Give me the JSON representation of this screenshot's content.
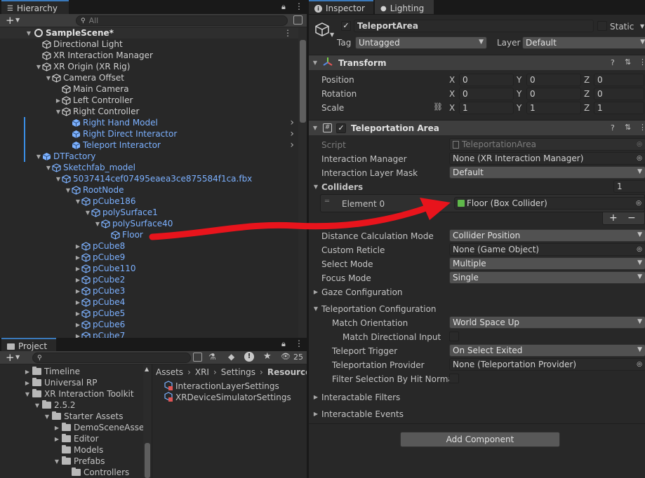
{
  "hierarchy": {
    "tab_label": "Hierarchy",
    "search_placeholder": "All",
    "scene_name": "SampleScene*",
    "rows": [
      {
        "label": "Directional Light",
        "depth": 1,
        "arrow": "",
        "color": "normal"
      },
      {
        "label": "XR Interaction Manager",
        "depth": 1,
        "arrow": "",
        "color": "normal"
      },
      {
        "label": "XR Origin (XR Rig)",
        "depth": 1,
        "arrow": "open",
        "color": "normal"
      },
      {
        "label": "Camera Offset",
        "depth": 2,
        "arrow": "open",
        "color": "normal"
      },
      {
        "label": "Main Camera",
        "depth": 3,
        "arrow": "",
        "color": "normal"
      },
      {
        "label": "Left Controller",
        "depth": 3,
        "arrow": "closed",
        "color": "normal"
      },
      {
        "label": "Right Controller",
        "depth": 3,
        "arrow": "open",
        "color": "normal"
      },
      {
        "label": "Right Hand Model",
        "depth": 4,
        "arrow": "",
        "color": "prefab"
      },
      {
        "label": "Right Direct Interactor",
        "depth": 4,
        "arrow": "",
        "color": "prefab"
      },
      {
        "label": "Teleport Interactor",
        "depth": 4,
        "arrow": "",
        "color": "prefab"
      },
      {
        "label": "DTFactory",
        "depth": 1,
        "arrow": "open",
        "color": "prefab"
      },
      {
        "label": "Sketchfab_model",
        "depth": 2,
        "arrow": "open",
        "color": "prefab"
      },
      {
        "label": "5037414cef07495eaea3ce875584f1ca.fbx",
        "depth": 3,
        "arrow": "open",
        "color": "prefab"
      },
      {
        "label": "RootNode",
        "depth": 4,
        "arrow": "open",
        "color": "prefab"
      },
      {
        "label": "pCube186",
        "depth": 5,
        "arrow": "open",
        "color": "prefab"
      },
      {
        "label": "polySurface1",
        "depth": 6,
        "arrow": "open",
        "color": "prefab"
      },
      {
        "label": "polySurface40",
        "depth": 7,
        "arrow": "open",
        "color": "prefab"
      },
      {
        "label": "Floor",
        "depth": 8,
        "arrow": "",
        "color": "prefab"
      },
      {
        "label": "pCube8",
        "depth": 5,
        "arrow": "closed",
        "color": "prefab"
      },
      {
        "label": "pCube9",
        "depth": 5,
        "arrow": "closed",
        "color": "prefab"
      },
      {
        "label": "pCube110",
        "depth": 5,
        "arrow": "closed",
        "color": "prefab"
      },
      {
        "label": "pCube2",
        "depth": 5,
        "arrow": "closed",
        "color": "prefab"
      },
      {
        "label": "pCube3",
        "depth": 5,
        "arrow": "closed",
        "color": "prefab"
      },
      {
        "label": "pCube4",
        "depth": 5,
        "arrow": "closed",
        "color": "prefab"
      },
      {
        "label": "pCube5",
        "depth": 5,
        "arrow": "closed",
        "color": "prefab"
      },
      {
        "label": "pCube6",
        "depth": 5,
        "arrow": "closed",
        "color": "prefab"
      },
      {
        "label": "pCube7",
        "depth": 5,
        "arrow": "closed",
        "color": "prefab"
      }
    ]
  },
  "project": {
    "tab_label": "Project",
    "hidden_count": "25",
    "tree": [
      {
        "label": "Timeline",
        "depth": 0,
        "arrow": "closed"
      },
      {
        "label": "Universal RP",
        "depth": 0,
        "arrow": "closed"
      },
      {
        "label": "XR Interaction Toolkit",
        "depth": 0,
        "arrow": "open"
      },
      {
        "label": "2.5.2",
        "depth": 1,
        "arrow": "open"
      },
      {
        "label": "Starter Assets",
        "depth": 2,
        "arrow": "open"
      },
      {
        "label": "DemoSceneAsse",
        "depth": 3,
        "arrow": "closed"
      },
      {
        "label": "Editor",
        "depth": 3,
        "arrow": "closed"
      },
      {
        "label": "Models",
        "depth": 3,
        "arrow": ""
      },
      {
        "label": "Prefabs",
        "depth": 3,
        "arrow": "open"
      },
      {
        "label": "Controllers",
        "depth": 4,
        "arrow": ""
      }
    ],
    "breadcrumb": [
      "Assets",
      "XRI",
      "Settings",
      "Resources"
    ],
    "files": [
      "InteractionLayerSettings",
      "XRDeviceSimulatorSettings"
    ]
  },
  "inspector": {
    "tab_label": "Inspector",
    "lighting_tab_label": "Lighting",
    "object_name": "TeleportArea",
    "static_label": "Static",
    "tag_label": "Tag",
    "tag_value": "Untagged",
    "layer_label": "Layer",
    "layer_value": "Default",
    "transform": {
      "title": "Transform",
      "position_label": "Position",
      "rotation_label": "Rotation",
      "scale_label": "Scale",
      "x": "X",
      "y": "Y",
      "z": "Z",
      "position": [
        "0",
        "0",
        "0"
      ],
      "rotation": [
        "0",
        "0",
        "0"
      ],
      "scale": [
        "1",
        "1",
        "1"
      ]
    },
    "teleport_area": {
      "title": "Teleportation Area",
      "script_label": "Script",
      "script_value": "TeleportationArea",
      "interaction_manager_label": "Interaction Manager",
      "interaction_manager_value": "None (XR Interaction Manager)",
      "layer_mask_label": "Interaction Layer Mask",
      "layer_mask_value": "Default",
      "colliders_label": "Colliders",
      "colliders_count": "1",
      "element0_label": "Element 0",
      "element0_value": "Floor (Box Collider)",
      "plus": "+",
      "minus": "−",
      "distance_label": "Distance Calculation Mode",
      "distance_value": "Collider Position",
      "reticle_label": "Custom Reticle",
      "reticle_value": "None (Game Object)",
      "select_mode_label": "Select Mode",
      "select_mode_value": "Multiple",
      "focus_mode_label": "Focus Mode",
      "focus_mode_value": "Single",
      "gaze_label": "Gaze Configuration",
      "teleport_config_label": "Teleportation Configuration",
      "match_orientation_label": "Match Orientation",
      "match_orientation_value": "World Space Up",
      "match_directional_label": "Match Directional Input",
      "teleport_trigger_label": "Teleport Trigger",
      "teleport_trigger_value": "On Select Exited",
      "teleport_provider_label": "Teleportation Provider",
      "teleport_provider_value": "None (Teleportation Provider)",
      "filter_label": "Filter Selection By Hit Normal",
      "interactable_filters_label": "Interactable Filters",
      "interactable_events_label": "Interactable Events"
    },
    "add_component_label": "Add Component"
  },
  "colors": {
    "prefab_blue": "#7cb1ff",
    "accent": "#3a79bb",
    "annotation_arrow": "#e8141c"
  }
}
